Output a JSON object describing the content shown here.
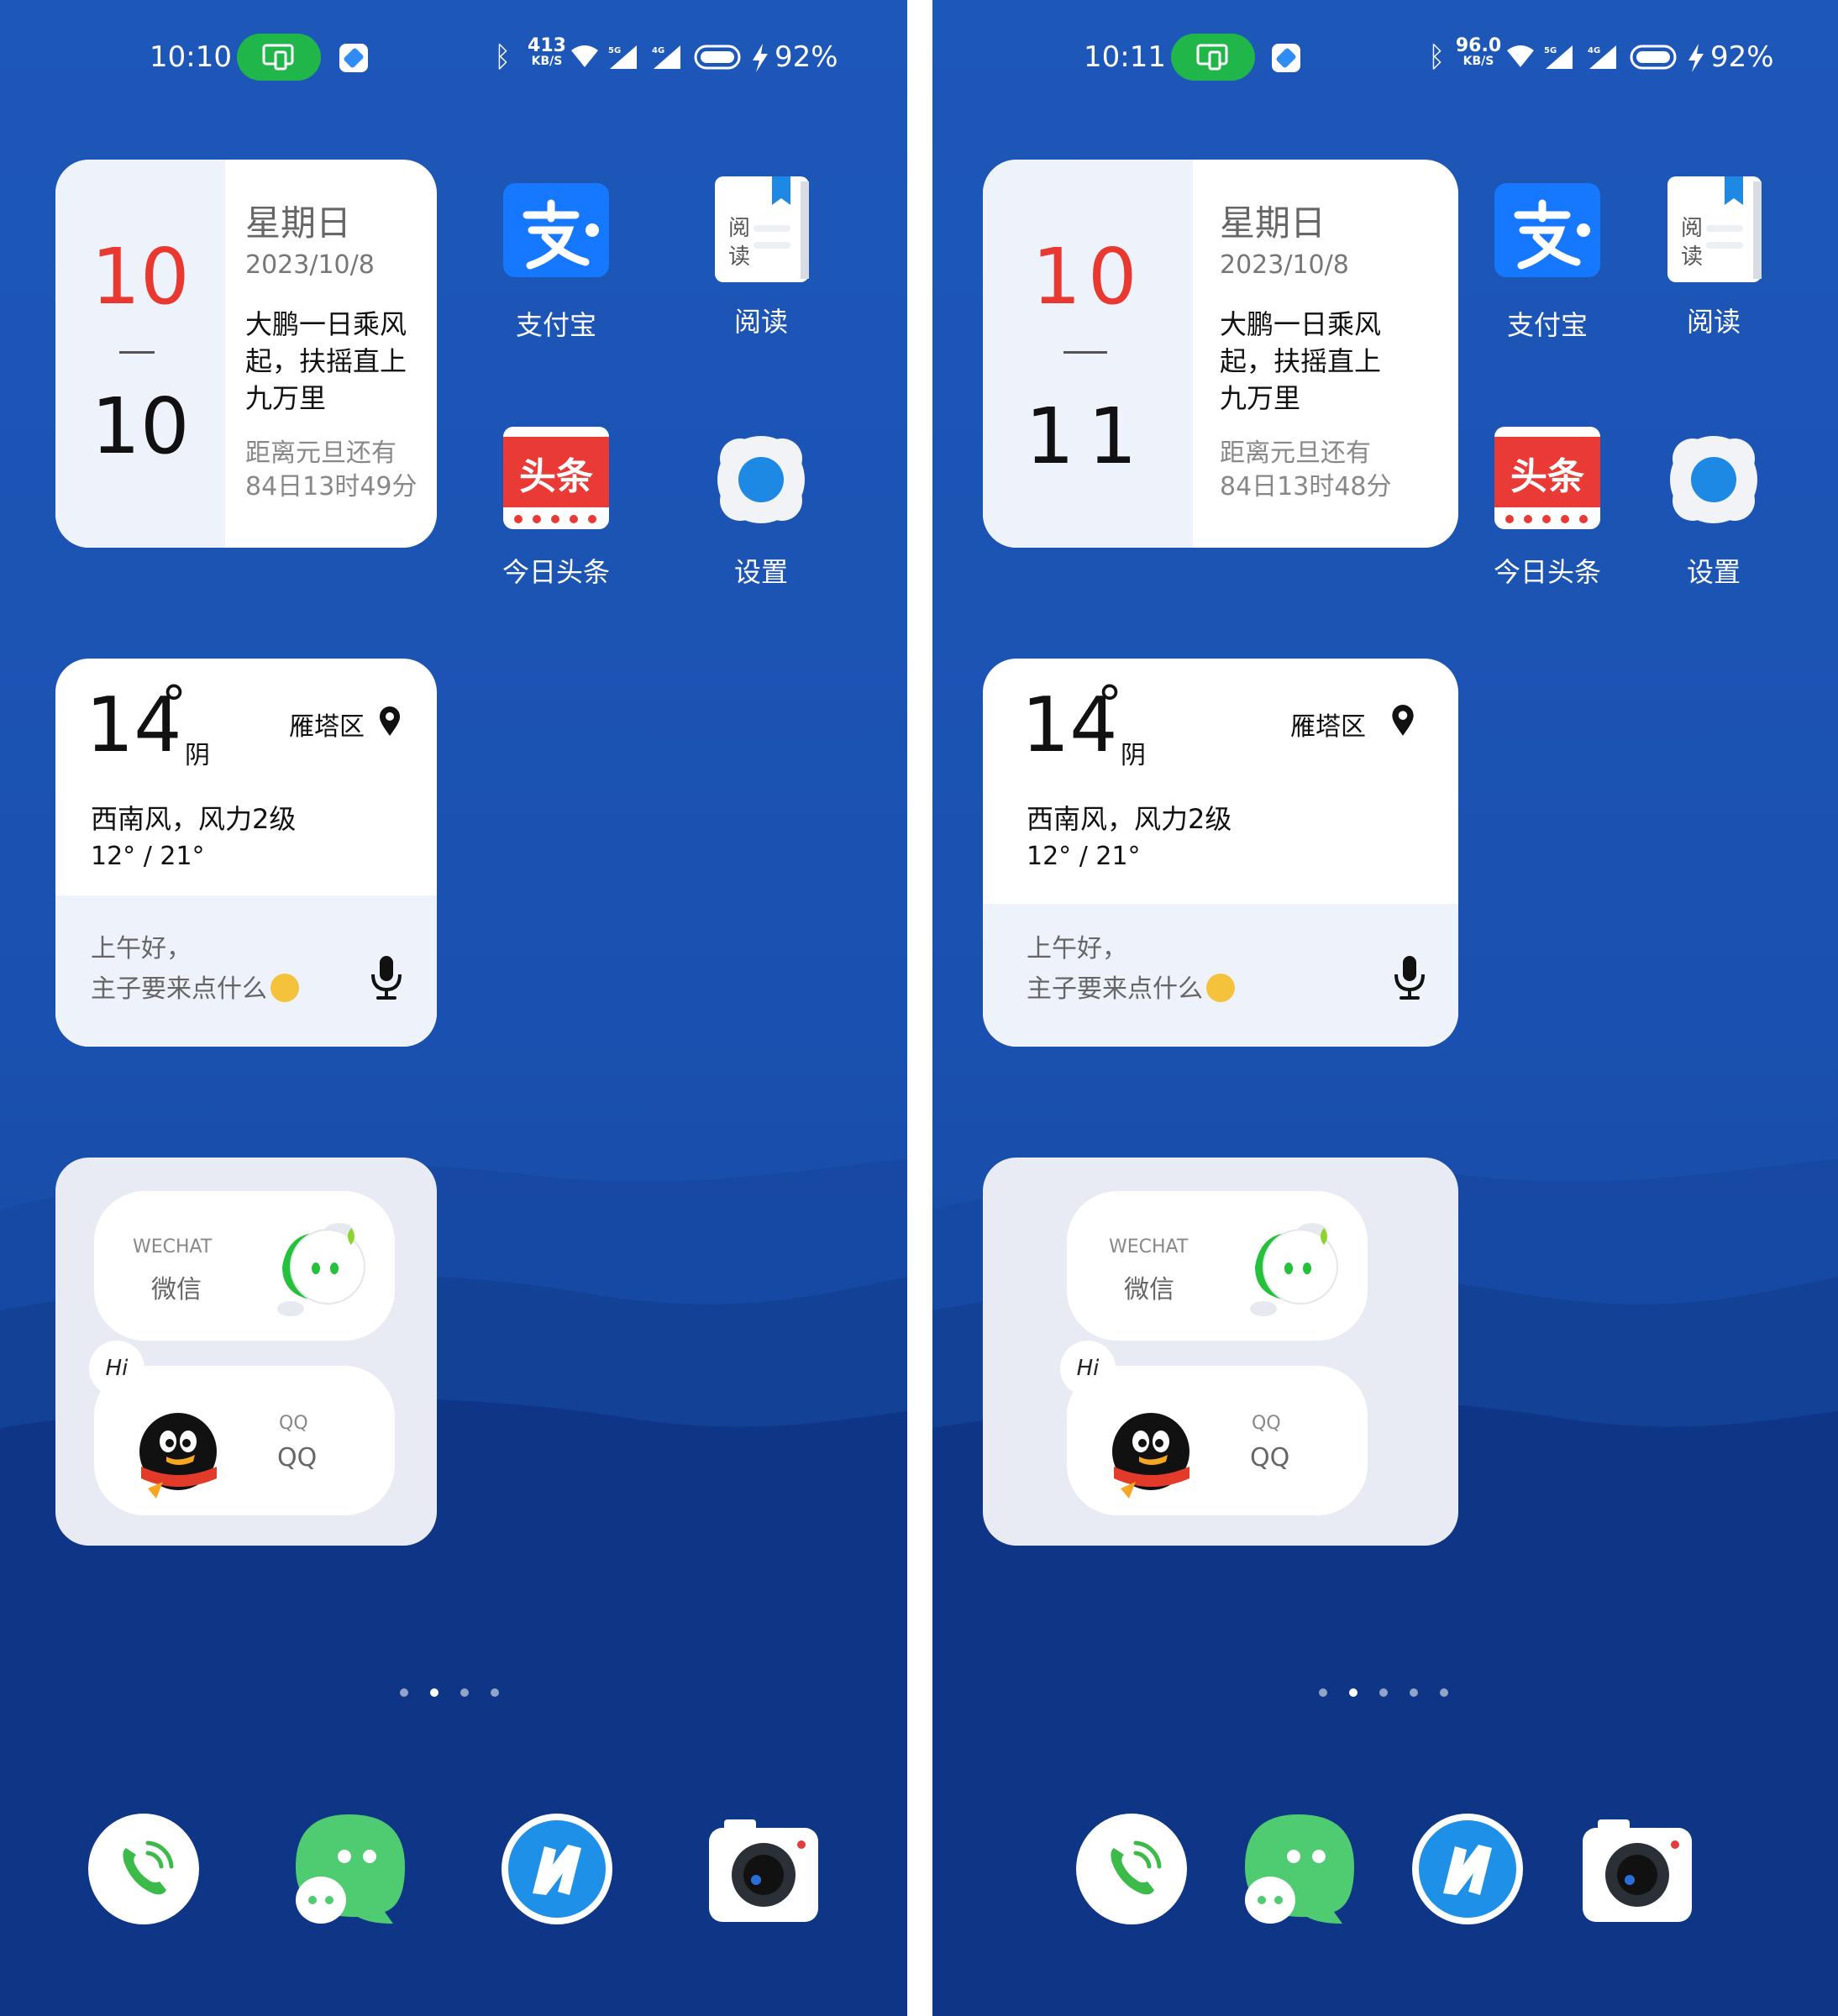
{
  "screens": [
    {
      "status": {
        "time": "10:10",
        "speed_value": "413",
        "speed_unit": "KB/S",
        "signal_labels": [
          "5G",
          "4G"
        ],
        "battery_percent": "92%"
      },
      "calendar": {
        "month": "10",
        "day": "10",
        "weekday": "星期日",
        "date": "2023/10/8",
        "poem": [
          "大鹏一日乘风",
          "起，扶摇直上",
          "九万里"
        ],
        "countdown": [
          "距离元旦还有",
          "84日13时49分"
        ]
      },
      "apps": [
        {
          "label": "支付宝",
          "icon": "alipay-icon"
        },
        {
          "label": "阅读",
          "icon": "book-icon",
          "glyph": [
            "阅",
            "读"
          ]
        },
        {
          "label": "今日头条",
          "icon": "toutiao-icon",
          "glyph": "头条"
        },
        {
          "label": "设置",
          "icon": "settings-icon"
        }
      ],
      "weather": {
        "temp": "14",
        "degree": "°",
        "condition": "阴",
        "location": "雁塔区",
        "wind": "西南风，风力2级",
        "range": "12° / 21°",
        "greeting_line1": "上午好，",
        "greeting_line2": "主子要来点什么"
      },
      "folder": {
        "wechat_en": "WECHAT",
        "wechat_cn": "微信",
        "qq_small": "QQ",
        "qq_big": "QQ",
        "hi": "Hi"
      },
      "page_count": 4,
      "active_page": 1,
      "dock": [
        "phone-icon",
        "messages-icon",
        "browser-icon",
        "camera-icon"
      ]
    },
    {
      "status": {
        "time": "10:11",
        "speed_value": "96.0",
        "speed_unit": "KB/S",
        "signal_labels": [
          "5G",
          "4G"
        ],
        "battery_percent": "92%"
      },
      "calendar": {
        "month": "10",
        "day": "11",
        "weekday": "星期日",
        "date": "2023/10/8",
        "poem": [
          "大鹏一日乘风",
          "起，扶摇直上",
          "九万里"
        ],
        "countdown": [
          "距离元旦还有",
          "84日13时48分"
        ]
      },
      "apps": [
        {
          "label": "支付宝",
          "icon": "alipay-icon"
        },
        {
          "label": "阅读",
          "icon": "book-icon",
          "glyph": [
            "阅",
            "读"
          ]
        },
        {
          "label": "今日头条",
          "icon": "toutiao-icon",
          "glyph": "头条"
        },
        {
          "label": "设置",
          "icon": "settings-icon"
        }
      ],
      "weather": {
        "temp": "14",
        "degree": "°",
        "condition": "阴",
        "location": "雁塔区",
        "wind": "西南风，风力2级",
        "range": "12° / 21°",
        "greeting_line1": "上午好，",
        "greeting_line2": "主子要来点什么"
      },
      "folder": {
        "wechat_en": "WECHAT",
        "wechat_cn": "微信",
        "qq_small": "QQ",
        "qq_big": "QQ",
        "hi": "Hi"
      },
      "page_count": 5,
      "active_page": 1,
      "dock": [
        "phone-icon",
        "messages-icon",
        "browser-icon",
        "camera-icon"
      ]
    }
  ],
  "colors": {
    "wallpaper": "#1d57b8",
    "accent_red": "#e8382f",
    "status_pill_green": "#21b64a",
    "card_tint": "#eef3fb"
  }
}
